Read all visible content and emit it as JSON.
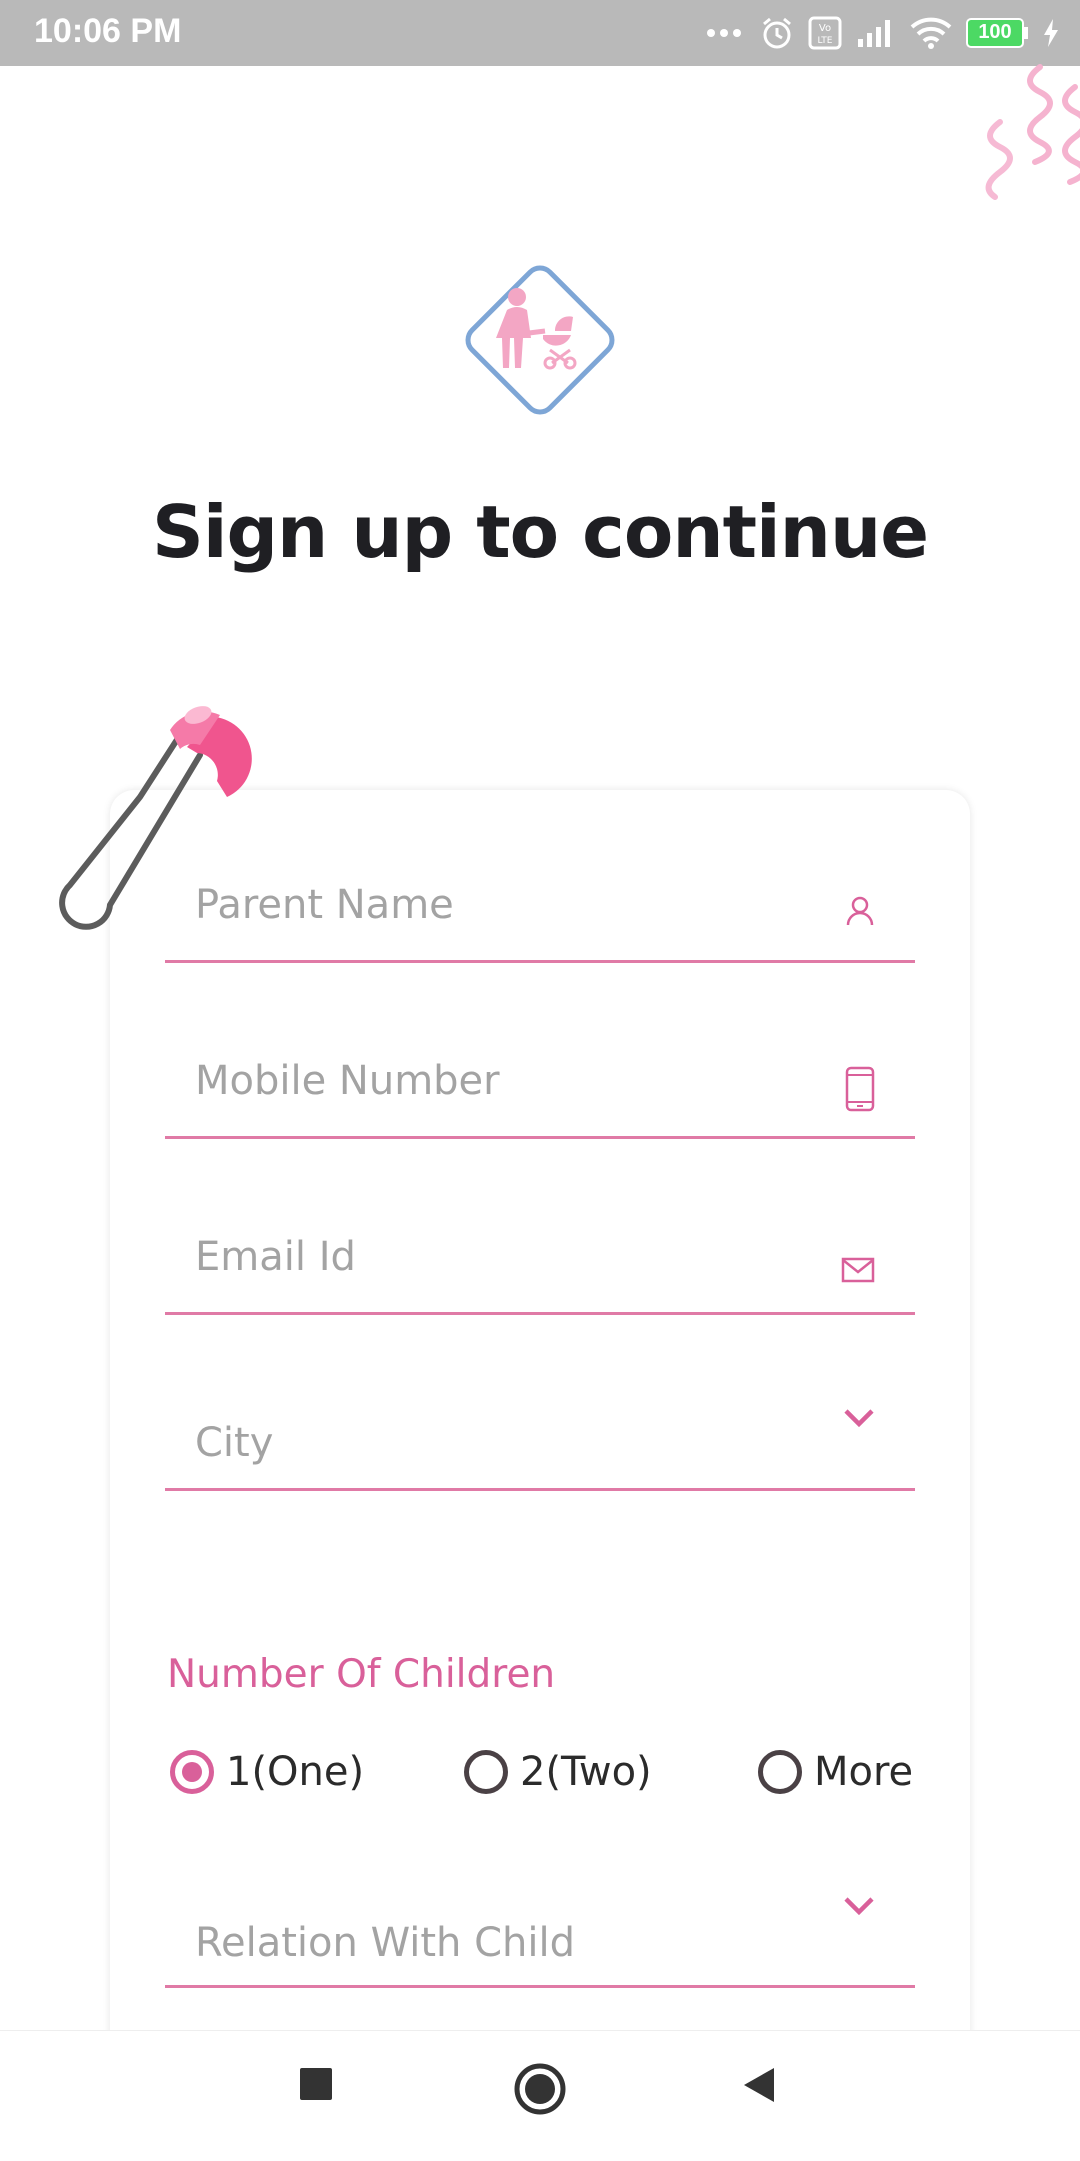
{
  "status_bar": {
    "time": "10:06 PM",
    "battery": "100"
  },
  "header": {
    "title": "Sign up to continue"
  },
  "form": {
    "parent_name_placeholder": "Parent Name",
    "mobile_placeholder": "Mobile Number",
    "email_placeholder": "Email Id",
    "city_label": "City",
    "children_label": "Number Of Children",
    "children_options": [
      "1(One)",
      "2(Two)",
      "More"
    ],
    "children_selected": "1(One)",
    "relation_label": "Relation With Child"
  },
  "colors": {
    "accent": "#d9609a",
    "underline": "#e07aa6",
    "logo_border": "#7ea6d6",
    "logo_figure": "#f3a6c4",
    "pin_head": "#f0558e"
  },
  "icons": {
    "parent_name": "person-icon",
    "mobile": "phone-icon",
    "email": "mail-icon",
    "city": "chevron-down-icon",
    "relation": "chevron-down-icon"
  }
}
